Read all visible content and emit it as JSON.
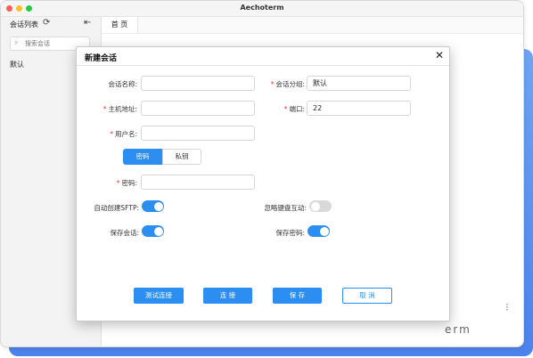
{
  "app": {
    "title": "Aechoterm"
  },
  "sidebar": {
    "title": "会话列表",
    "refresh_icon": "refresh-icon",
    "collapse_icon": "collapse-sidebar-icon",
    "search": {
      "placeholder": "搜索会话",
      "value": ""
    },
    "groups": [
      {
        "label": "默认"
      }
    ]
  },
  "tabs": [
    {
      "label": "首 页"
    }
  ],
  "decor": {
    "corner_text": "erm"
  },
  "colors": {
    "accent": "#2b8ef0",
    "required": "#e53935",
    "backdrop": "#5a8ff0"
  },
  "modal": {
    "title": "新建会话",
    "close_icon": "close-icon",
    "fields": {
      "session_name": {
        "label": "会话名称:",
        "value": ""
      },
      "session_group": {
        "label": "会话分组:",
        "value": "默认"
      },
      "host": {
        "label": "主机地址:",
        "value": ""
      },
      "port": {
        "label": "端口:",
        "value": "22"
      },
      "username": {
        "label": "用户名:",
        "value": ""
      },
      "password": {
        "label": "密码:",
        "value": ""
      }
    },
    "auth_tabs": [
      {
        "label": "密码",
        "selected": true
      },
      {
        "label": "私钥",
        "selected": false
      }
    ],
    "toggles": {
      "auto_sftp": {
        "label": "自动创建SFTP:",
        "on": true
      },
      "ignore_keyboard": {
        "label": "忽略键盘互动:",
        "on": false
      },
      "save_session": {
        "label": "保存会话:",
        "on": true
      },
      "save_password": {
        "label": "保存密码:",
        "on": true
      }
    },
    "buttons": {
      "test": "测试连接",
      "connect": "连 接",
      "save": "保 存",
      "cancel": "取 消"
    },
    "required_mark": "*"
  }
}
